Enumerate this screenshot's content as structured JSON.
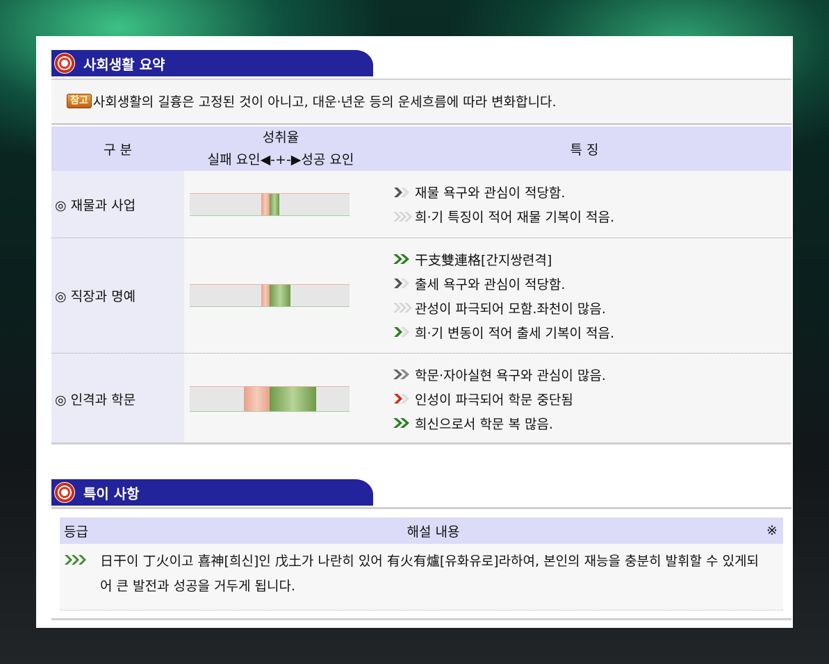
{
  "summary_section": {
    "title": "사회생활 요약",
    "notice_badge": "참고",
    "notice_text": "사회생활의 길흉은 고정된 것이 아니고, 대운·년운 등의 운세흐름에 따라 변화합니다."
  },
  "table": {
    "header": {
      "category": "구 분",
      "rate_title": "성취율",
      "rate_legend_fail": "실패 요인",
      "rate_legend_mid": "◀-+-▶",
      "rate_legend_success": "성공 요인",
      "features": "특 징"
    },
    "rows": [
      {
        "category": "◎ 재물과 사업",
        "bar": {
          "fail": 0.05,
          "success": 0.06
        },
        "features": [
          {
            "icon": "single-gray",
            "text": "재물 욕구와 관심이 적당함."
          },
          {
            "icon": "light-triple",
            "text": "희·기 특징이 적어 재물 기복이 적음."
          }
        ]
      },
      {
        "category": "◎ 직장과 명예",
        "bar": {
          "fail": 0.05,
          "success": 0.13
        },
        "features": [
          {
            "icon": "green-double",
            "text": "干支雙連格[간지쌍련격]"
          },
          {
            "icon": "single-gray",
            "text": "출세 욕구와 관심이 적당함."
          },
          {
            "icon": "light-triple",
            "text": "관성이 파극되어 모함.좌천이 많음."
          },
          {
            "icon": "single-green",
            "text": "희·기 변동이 적어 출세 기복이 적음."
          }
        ]
      },
      {
        "category": "◎ 인격과 학문",
        "bar": {
          "fail": 0.16,
          "success": 0.29
        },
        "features": [
          {
            "icon": "gray-double",
            "text": "학문·자아실현 욕구와 관심이 많음."
          },
          {
            "icon": "red-single",
            "text": "인성이 파극되어 학문 중단됨"
          },
          {
            "icon": "green-double",
            "text": "희신으로서 학문 복 많음."
          }
        ]
      }
    ]
  },
  "special_section": {
    "title": "특이 사항",
    "head_grade": "등급",
    "head_content": "해설 내용",
    "head_mark": "※",
    "items": [
      {
        "icon": "green-triple",
        "text": "日干이 丁火이고 喜神[희신]인 戊土가 나란히 있어 有火有爐[유화유로]라하여, 본인의 재능을 충분히 발휘할 수 있게되어 큰 발전과 성공을 거두게 됩니다."
      }
    ]
  },
  "colors": {
    "tab_bg": "#23239b",
    "header_bg": "#dcdcf8",
    "fail_bar": "#e8a088",
    "success_bar": "#6e9a48"
  }
}
